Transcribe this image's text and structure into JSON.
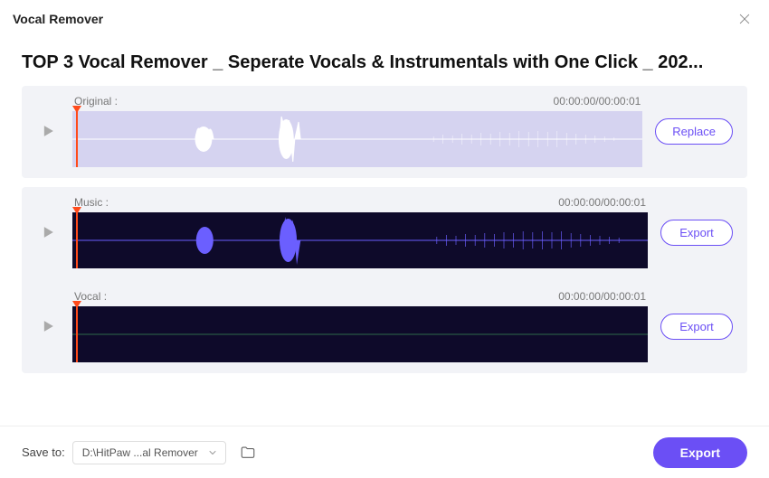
{
  "window": {
    "title": "Vocal Remover"
  },
  "main": {
    "title": "TOP 3 Vocal Remover _ Seperate Vocals & Instrumentals with One Click _ 202..."
  },
  "tracks": {
    "original": {
      "label": "Original :",
      "time": "00:00:00/00:00:01",
      "button": "Replace"
    },
    "music": {
      "label": "Music :",
      "time": "00:00:00/00:00:01",
      "button": "Export"
    },
    "vocal": {
      "label": "Vocal :",
      "time": "00:00:00/00:00:01",
      "button": "Export"
    }
  },
  "footer": {
    "save_label": "Save to:",
    "save_path": "D:\\HitPaw ...al Remover",
    "export_label": "Export"
  }
}
